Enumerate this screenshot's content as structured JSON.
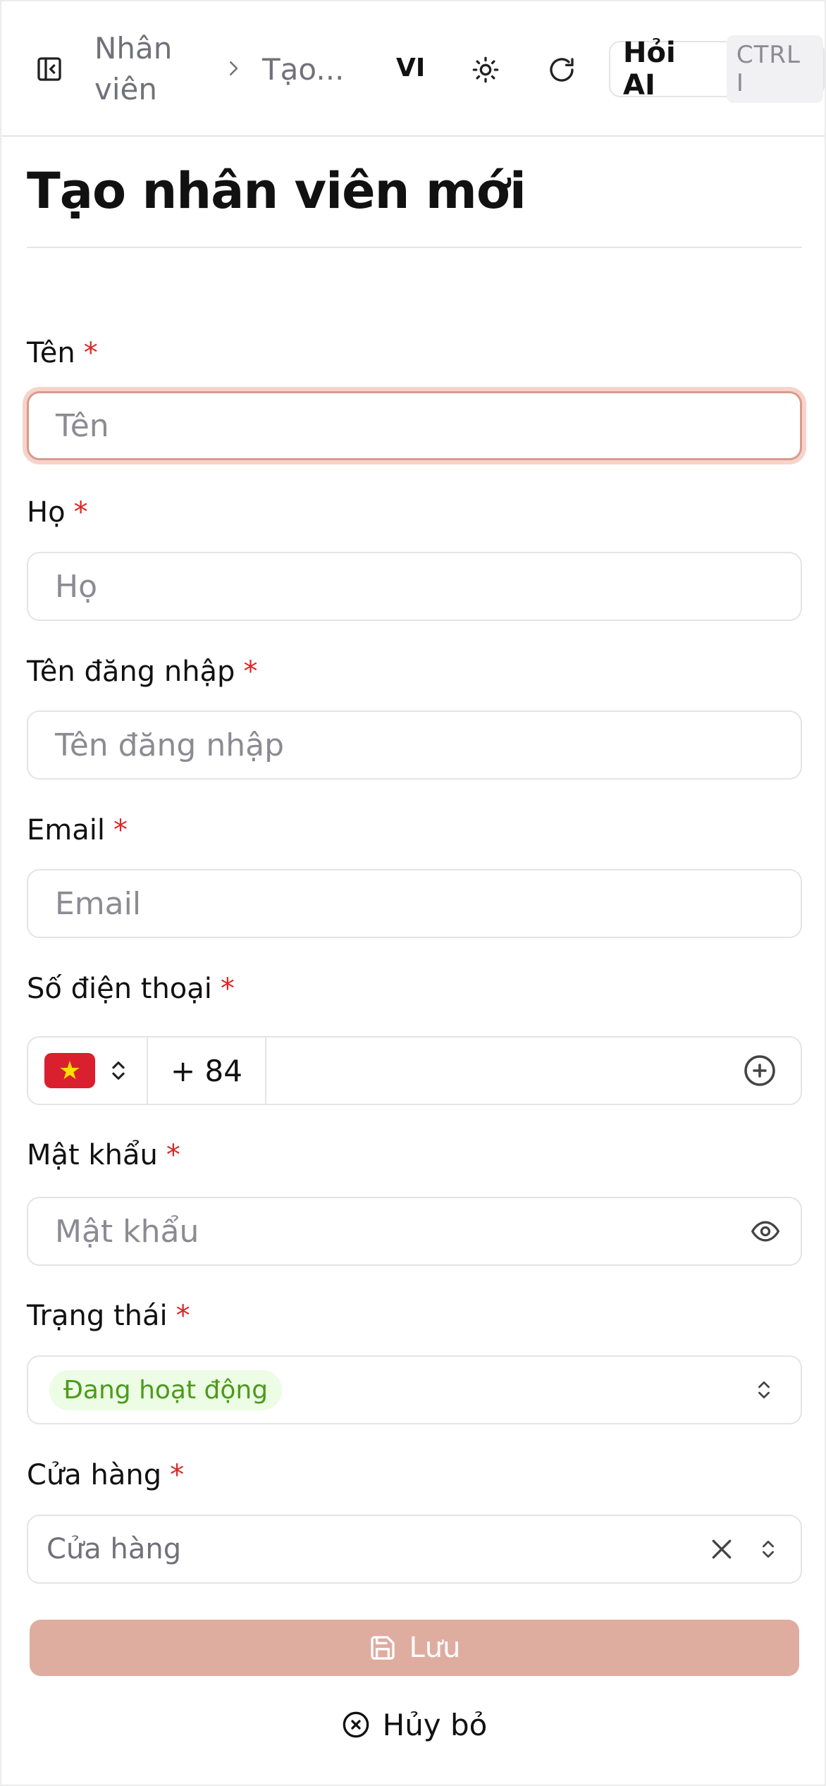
{
  "header": {
    "breadcrumb": [
      "Nhân",
      "viên",
      "Tạo..."
    ],
    "language": "VI",
    "ask_ai": {
      "label": "Hỏi AI",
      "shortcut": "CTRL I"
    }
  },
  "page": {
    "title": "Tạo nhân viên mới"
  },
  "form": {
    "required_mark": "*",
    "first_name": {
      "label": "Tên",
      "placeholder": "Tên",
      "state": "error"
    },
    "last_name": {
      "label": "Họ",
      "placeholder": "Họ"
    },
    "username": {
      "label": "Tên đăng nhập",
      "placeholder": "Tên đăng nhập"
    },
    "email": {
      "label": "Email",
      "placeholder": "Email"
    },
    "phone": {
      "label": "Số điện thoại",
      "country_flag": "★",
      "dial_code": "+ 84",
      "value": ""
    },
    "password": {
      "label": "Mật khẩu",
      "placeholder": "Mật khẩu"
    },
    "status": {
      "label": "Trạng thái",
      "value": "Đang hoạt động",
      "color": "#4d9a1a"
    },
    "store": {
      "label": "Cửa hàng",
      "placeholder": "Cửa hàng"
    }
  },
  "actions": {
    "save": "Lưu",
    "cancel": "Hủy bỏ"
  },
  "colors": {
    "required": "#dc2626",
    "save_disabled": "#dfaca0",
    "error_border": "#d99a8c"
  }
}
